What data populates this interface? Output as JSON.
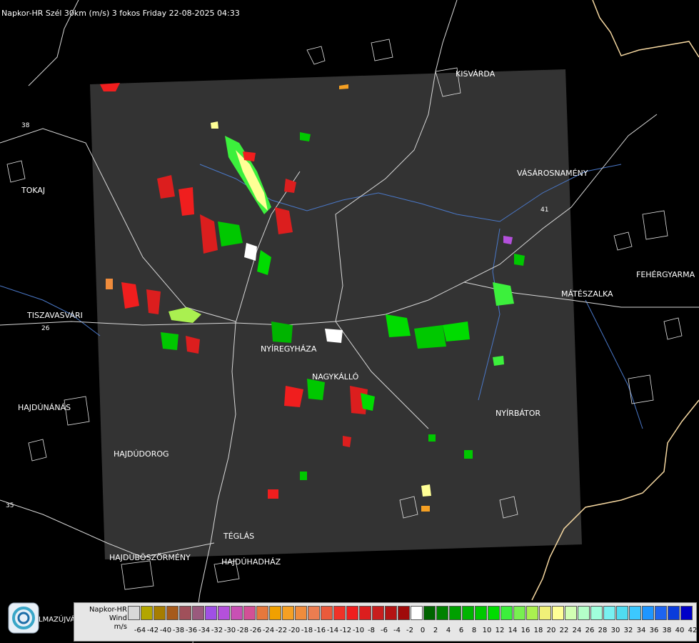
{
  "header": {
    "title": "Napkor-HR Szél 30km (m/s) 3 fokos Friday 22-08-2025 04:33"
  },
  "towns": [
    {
      "name": "KISVÁRDA"
    },
    {
      "name": "VÁSÁROSNAMÉNY"
    },
    {
      "name": "TOKAJ"
    },
    {
      "name": "FEHÉRGYARMA"
    },
    {
      "name": "MÁTÉSZALKA"
    },
    {
      "name": "TISZAVASVÁRI"
    },
    {
      "name": "NYÍREGYHÁZA"
    },
    {
      "name": "NAGYKÁLLÓ"
    },
    {
      "name": "HAJDÚNÁNÁS"
    },
    {
      "name": "NYÍRBÁTOR"
    },
    {
      "name": "HAJDÚDOROG"
    },
    {
      "name": "TÉGLÁS"
    },
    {
      "name": "HAJDÚBÖSZÖRMÉNY"
    },
    {
      "name": "HAJDÚHADHÁZ"
    },
    {
      "name": "LMAZÚJVÁR"
    }
  ],
  "road_labels": [
    "38",
    "26",
    "41",
    "35"
  ],
  "legend": {
    "title_lines": [
      "Napkor-HR",
      "Wind",
      "m/s"
    ],
    "values": [
      "-64",
      "-42",
      "-40",
      "-38",
      "-36",
      "-34",
      "-32",
      "-30",
      "-28",
      "-26",
      "-24",
      "-22",
      "-20",
      "-18",
      "-16",
      "-14",
      "-12",
      "-10",
      "-8",
      "-6",
      "-4",
      "-2",
      "0",
      "2",
      "4",
      "6",
      "8",
      "10",
      "12",
      "14",
      "16",
      "18",
      "20",
      "22",
      "24",
      "26",
      "28",
      "30",
      "32",
      "34",
      "36",
      "38",
      "40",
      "42"
    ],
    "colors": [
      "#d9d9d9",
      "#b3a600",
      "#a67d00",
      "#a65a1a",
      "#a0505a",
      "#9a5a7d",
      "#a050e6",
      "#b450dc",
      "#c850b4",
      "#d25096",
      "#e6783c",
      "#f0a000",
      "#f5a023",
      "#f08c3c",
      "#eb7d50",
      "#eb5a3c",
      "#f03228",
      "#f01e1e",
      "#dc1e1e",
      "#c81e1e",
      "#b41414",
      "#a00a0a",
      "#ffffff",
      "#006400",
      "#008200",
      "#00a000",
      "#00b400",
      "#00c800",
      "#00dc00",
      "#3cf03c",
      "#78f050",
      "#aaf050",
      "#f0f078",
      "#ffff96",
      "#d2ffb4",
      "#b4ffc8",
      "#a0ffdc",
      "#78f0f0",
      "#50dcf0",
      "#3cc8ff",
      "#1e96ff",
      "#1e64f0",
      "#0a3cdc",
      "#0000c8"
    ]
  },
  "colors": {
    "radar_bg": "#333333",
    "roads": "#d9d9d9",
    "rivers": "#4a78c8",
    "border": "#f5d7a0"
  }
}
